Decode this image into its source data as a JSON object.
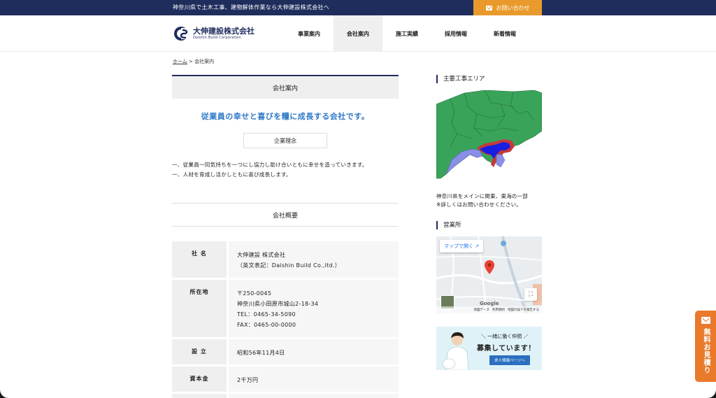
{
  "topbar": {
    "tagline": "神奈川県で土木工事、建物解体作業なら大伸建設株式会社へ",
    "contact_label": "お問い合わせ"
  },
  "header": {
    "logo_name": "大伸建設株式会社",
    "logo_sub": "Daishin Build Corporation",
    "nav": [
      {
        "label": "事業案内"
      },
      {
        "label": "会社案内"
      },
      {
        "label": "施工実績"
      },
      {
        "label": "採用情報"
      },
      {
        "label": "新着情報"
      }
    ],
    "active_index": 1
  },
  "breadcrumb": {
    "home": "ホーム",
    "separator": ">",
    "current": "会社案内"
  },
  "main": {
    "section_title": "会社案内",
    "catch": "従業員の幸せと喜びを糧に成長する会社です。",
    "philosophy_label": "企業理念",
    "philosophy_lines": [
      "一、従業員一同気持ちを一つにし協力し助け合いともに幸せを造っていきます。",
      "一、人材を育成し活かしともに喜び成長します。"
    ],
    "overview_title": "会社概要",
    "overview": [
      {
        "label": "社 名",
        "lines": [
          "大伸建設 株式会社",
          "（英文表記：Daishin Build Co.,ltd.）"
        ]
      },
      {
        "label": "所在地",
        "lines": [
          "〒250-0045",
          "神奈川県小田原市城山2-18-34",
          "TEL：0465-34-5090",
          "FAX：0465-00-0000"
        ]
      },
      {
        "label": "設 立",
        "lines": [
          "昭和56年11月4日"
        ]
      },
      {
        "label": "資本金",
        "lines": [
          "2千万円"
        ]
      }
    ]
  },
  "sidebar": {
    "area_title": "主要工事エリア",
    "area_note_lines": [
      "神奈川県をメインに関東、東海の一部",
      "※詳しくはお問い合わせください。"
    ],
    "office_title": "営業所",
    "map_open_label": "マップで開く",
    "map_google": "Google",
    "map_footer": [
      "地図データ",
      "利用規約",
      "地図の誤りを報告する"
    ],
    "recruit_sub": "＼ 一緒に働く仲間 ／",
    "recruit_main": "募集しています！",
    "recruit_button": "求人情報ページへ"
  },
  "float_tab": {
    "label": "無料お見積り"
  },
  "colors": {
    "navy": "#1f2d5c",
    "orange": "#e99a2c",
    "blue_text": "#2e78c6",
    "map_green": "#3aa35a",
    "map_lavender": "#8a8fe6",
    "map_kanagawa": "#1a1ee0"
  }
}
